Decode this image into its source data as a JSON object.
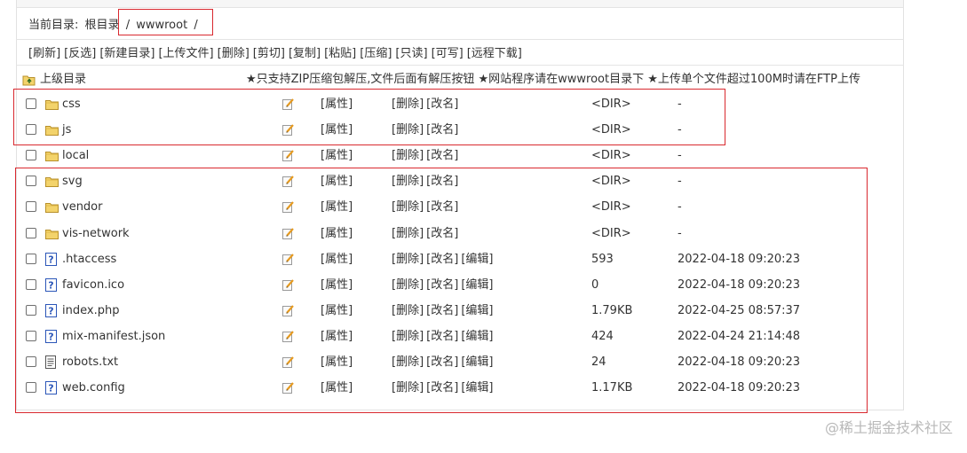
{
  "path": {
    "label": "当前目录:",
    "root": "根目录",
    "sep": "/",
    "dir": "wwwroot",
    "trail": "/"
  },
  "toolbar": [
    "[刷新]",
    "[反选]",
    "[新建目录]",
    "[上传文件]",
    "[删除]",
    "[剪切]",
    "[复制]",
    "[粘贴]",
    "[压缩]",
    "[只读]",
    "[可写]",
    "[远程下载]"
  ],
  "up_label": "上级目录",
  "notice": "★只支持ZIP压缩包解压,文件后面有解压按钮 ★网站程序请在wwwroot目录下 ★上传单个文件超过100M时请在FTP上传",
  "labels": {
    "prop": "[属性]",
    "del": "[删除]",
    "rename": "[改名]",
    "edit": "[编辑]"
  },
  "files": [
    {
      "name": "css",
      "type": "dir",
      "size": "<DIR>",
      "date": "-"
    },
    {
      "name": "js",
      "type": "dir",
      "size": "<DIR>",
      "date": "-"
    },
    {
      "name": "local",
      "type": "dir",
      "size": "<DIR>",
      "date": "-"
    },
    {
      "name": "svg",
      "type": "dir",
      "size": "<DIR>",
      "date": "-"
    },
    {
      "name": "vendor",
      "type": "dir",
      "size": "<DIR>",
      "date": "-"
    },
    {
      "name": "vis-network",
      "type": "dir",
      "size": "<DIR>",
      "date": "-"
    },
    {
      "name": ".htaccess",
      "type": "unknown",
      "size": "593",
      "date": "2022-04-18 09:20:23"
    },
    {
      "name": "favicon.ico",
      "type": "unknown",
      "size": "0",
      "date": "2022-04-18 09:20:23"
    },
    {
      "name": "index.php",
      "type": "unknown",
      "size": "1.79KB",
      "date": "2022-04-25 08:57:37"
    },
    {
      "name": "mix-manifest.json",
      "type": "unknown",
      "size": "424",
      "date": "2022-04-24 21:14:48"
    },
    {
      "name": "robots.txt",
      "type": "text",
      "size": "24",
      "date": "2022-04-18 09:20:23"
    },
    {
      "name": "web.config",
      "type": "unknown",
      "size": "1.17KB",
      "date": "2022-04-18 09:20:23"
    }
  ],
  "icons": {
    "folder": "folder-icon",
    "unknown": "unknown-file-icon",
    "text": "text-file-icon",
    "edit": "edit-pencil-icon",
    "up": "up-folder-icon"
  },
  "colors": {
    "highlight": "#d9292f",
    "folder": "#f3d36b",
    "border": "#e2e2e2"
  },
  "watermark": "@稀土掘金技术社区"
}
